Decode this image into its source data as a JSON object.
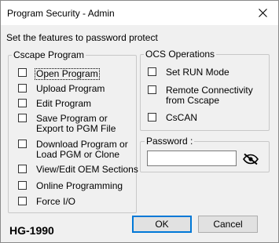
{
  "window": {
    "title": "Program Security - Admin",
    "prompt": "Set the features to password protect",
    "footer_code": "HG-1990"
  },
  "cscape": {
    "legend": "Cscape Program",
    "items": [
      {
        "label": "Open Program",
        "checked": false,
        "focused": true
      },
      {
        "label": "Upload Program",
        "checked": false
      },
      {
        "label": "Edit Program",
        "checked": false
      },
      {
        "label": "Save Program or",
        "label2": "Export to PGM File",
        "checked": false
      },
      {
        "label": "Download Program or",
        "label2": "Load PGM or Clone",
        "checked": false
      },
      {
        "label": "View/Edit OEM Sections",
        "checked": false
      },
      {
        "label": "Online Programming",
        "checked": false
      },
      {
        "label": "Force I/O",
        "checked": false
      }
    ]
  },
  "ocs": {
    "legend": "OCS Operations",
    "items": [
      {
        "label": "Set RUN Mode",
        "checked": false
      },
      {
        "label": "Remote Connectivity",
        "label2": "from Cscape",
        "checked": false
      },
      {
        "label": "CsCAN",
        "checked": false
      }
    ]
  },
  "password": {
    "legend": "Password :",
    "value": "",
    "toggle_icon": "eye-slash-icon"
  },
  "buttons": {
    "ok": "OK",
    "cancel": "Cancel"
  }
}
